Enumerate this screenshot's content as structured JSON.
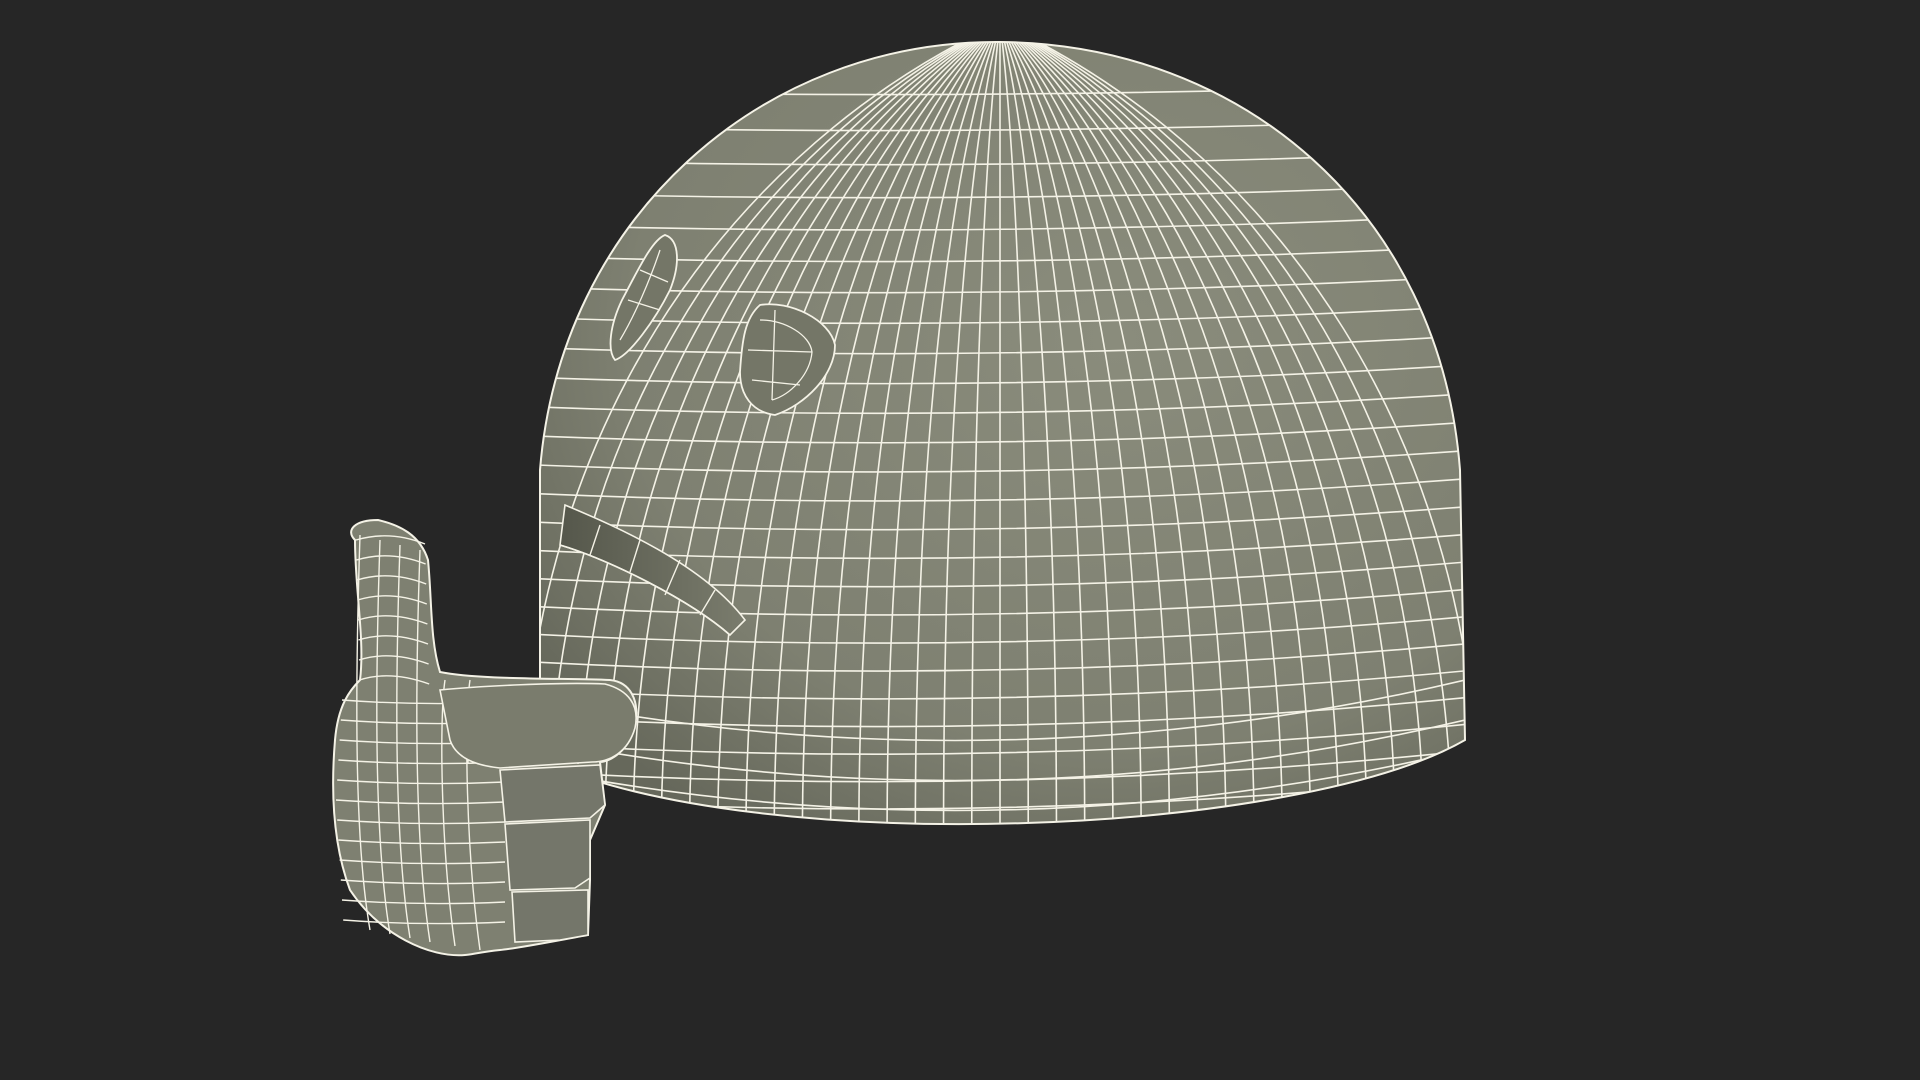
{
  "scene": {
    "subject": "emoji-head-thumbs-up-wireframe",
    "background_color": "#262626",
    "surface_color": "#7e8071",
    "surface_dark_color": "#5f6155",
    "wire_color": "#f4f2e6"
  }
}
